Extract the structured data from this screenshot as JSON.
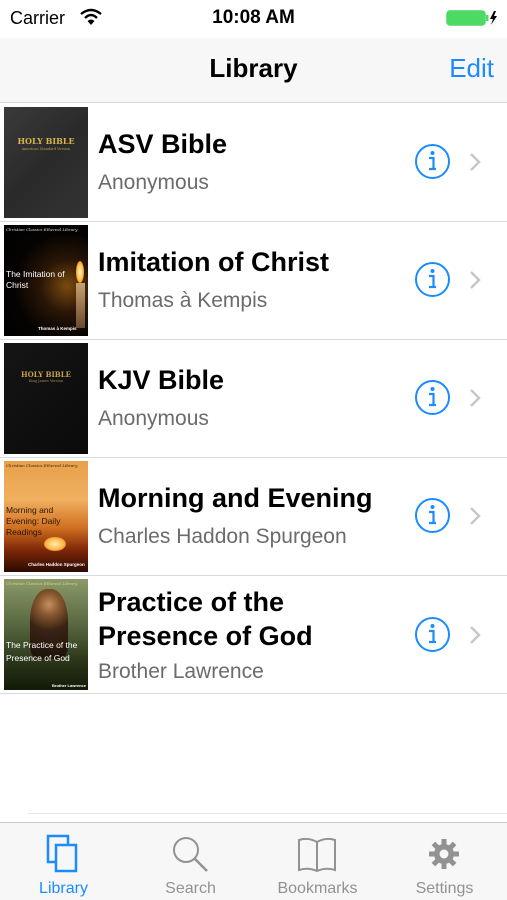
{
  "status_bar": {
    "carrier": "Carrier",
    "time": "10:08 AM"
  },
  "nav": {
    "title": "Library",
    "edit_label": "Edit"
  },
  "books": [
    {
      "title": "ASV Bible",
      "author": "Anonymous",
      "cover_heading": "HOLY BIBLE",
      "cover_sub": "American Standard Version"
    },
    {
      "title": "Imitation of Christ",
      "author": "Thomas à Kempis",
      "cover_series": "Christian Classics Ethereal Library",
      "cover_heading": "The Imitation of Christ",
      "cover_author": "Thomas à Kempis"
    },
    {
      "title": "KJV Bible",
      "author": "Anonymous",
      "cover_heading": "HOLY BIBLE",
      "cover_sub": "King James Version"
    },
    {
      "title": "Morning and Evening",
      "author": "Charles Haddon Spurgeon",
      "cover_series": "Christian Classics Ethereal Library",
      "cover_heading": "Morning and Evening: Daily Readings",
      "cover_author": "Charles Haddon Spurgeon"
    },
    {
      "title": "Practice of the Presence of God",
      "title_line1": "Practice of the",
      "title_line2": "Presence of God",
      "author": "Brother Lawrence",
      "cover_series": "Christian Classics Ethereal Library",
      "cover_heading": "The Practice of the Presence of God",
      "cover_author": "Brother Lawrence"
    }
  ],
  "tabs": [
    {
      "label": "Library",
      "icon": "library-icon",
      "active": true
    },
    {
      "label": "Search",
      "icon": "search-icon",
      "active": false
    },
    {
      "label": "Bookmarks",
      "icon": "bookmarks-icon",
      "active": false
    },
    {
      "label": "Settings",
      "icon": "gear-icon",
      "active": false
    }
  ],
  "colors": {
    "accent": "#1a8cff",
    "battery": "#4cd964",
    "secondary_text": "#6b6b6b",
    "inactive_tab": "#929292"
  }
}
